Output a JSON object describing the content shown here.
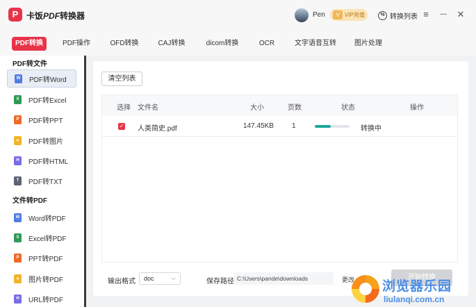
{
  "app": {
    "logo_letter": "P",
    "title_prefix": "卡饭",
    "title_pdf": "PDF",
    "title_suffix": "转换器"
  },
  "header": {
    "username": "Pen",
    "vip_label": "VIP充值",
    "vip_icon": "V",
    "convert_list_label": "转换列表",
    "convert_list_icon": "%"
  },
  "window_controls": {
    "menu": "≡",
    "minimize": "—",
    "close": "✕"
  },
  "tabs": [
    {
      "label": "PDF转换",
      "active": true
    },
    {
      "label": "PDF操作"
    },
    {
      "label": "OFD转换"
    },
    {
      "label": "CAJ转换"
    },
    {
      "label": "dicom转换"
    },
    {
      "label": "OCR"
    },
    {
      "label": "文字语音互转"
    },
    {
      "label": "图片处理"
    }
  ],
  "sidebar": {
    "section1_title": "PDF转文件",
    "section1_items": [
      {
        "label": "PDF转Word",
        "icon_letter": "W",
        "color": "#4f7de3",
        "active": true
      },
      {
        "label": "PDF转Excel",
        "icon_letter": "X",
        "color": "#2e9a57"
      },
      {
        "label": "PDF转PPT",
        "icon_letter": "P",
        "color": "#f06a2a"
      },
      {
        "label": "PDF转图片",
        "icon_letter": "▲",
        "color": "#f3b32a"
      },
      {
        "label": "PDF转HTML",
        "icon_letter": "H",
        "color": "#7a6de8"
      },
      {
        "label": "PDF转TXT",
        "icon_letter": "T",
        "color": "#5a6474"
      }
    ],
    "section2_title": "文件转PDF",
    "section2_items": [
      {
        "label": "Word转PDF",
        "icon_letter": "W",
        "color": "#4f7de3"
      },
      {
        "label": "Excel转PDF",
        "icon_letter": "X",
        "color": "#2e9a57"
      },
      {
        "label": "PPT转PDF",
        "icon_letter": "P",
        "color": "#f06a2a"
      },
      {
        "label": "图片转PDF",
        "icon_letter": "▲",
        "color": "#f3b32a"
      },
      {
        "label": "URL转PDF",
        "icon_letter": "H",
        "color": "#7a6de8"
      }
    ]
  },
  "main": {
    "clear_button": "清空列表",
    "table": {
      "headers": {
        "select": "选择",
        "filename": "文件名",
        "size": "大小",
        "pages": "页数",
        "status": "状态",
        "action": "操作"
      },
      "rows": [
        {
          "checked": true,
          "check_mark": "✓",
          "filename": "人类简史.pdf",
          "size": "147.45KB",
          "pages": "1",
          "progress": 0.45,
          "status": "转换中"
        }
      ]
    },
    "output_format_label": "输出格式",
    "output_format_value": "doc",
    "output_format_chevron": "⌵",
    "save_path_label": "保存路径",
    "save_path_value": "C:\\Users\\pande\\downloads",
    "change_label": "更改",
    "start_button": "开始转换"
  },
  "watermark": {
    "cn": "浏览器乐园",
    "en": "liulanqi.com.cn"
  },
  "colors": {
    "accent": "#e8344a",
    "progress": "#1aa79b",
    "watermark": "#4a8ee8"
  }
}
